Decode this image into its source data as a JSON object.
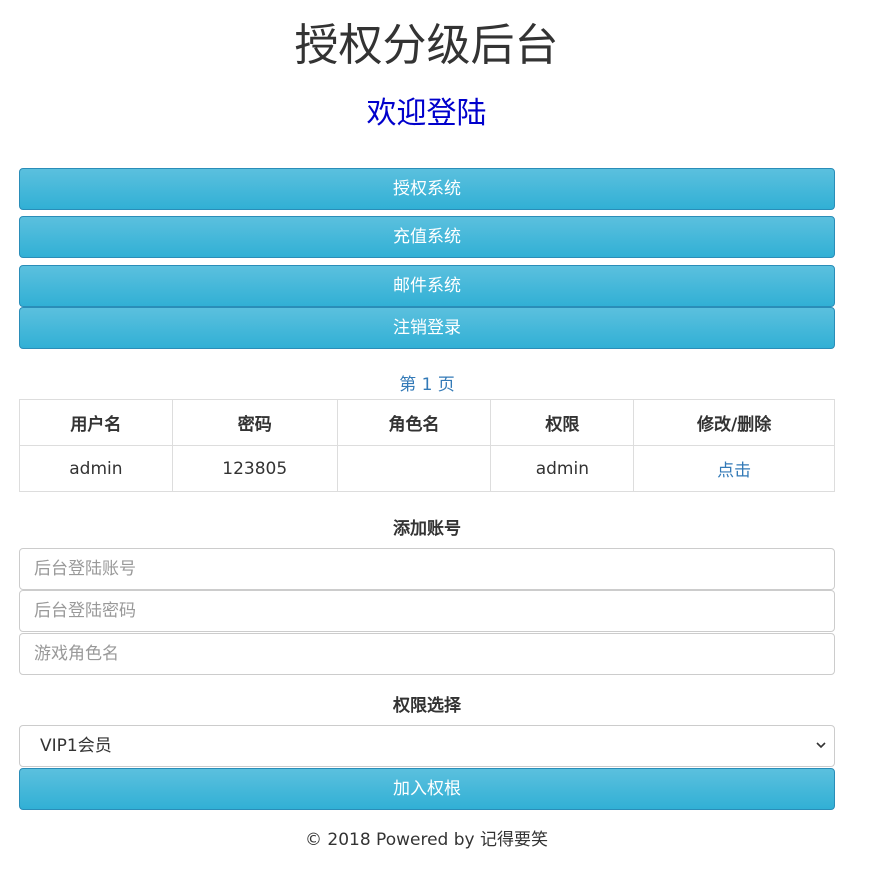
{
  "header": {
    "title": "授权分级后台",
    "welcome": "欢迎登陆"
  },
  "nav": {
    "buttons": [
      {
        "label": "授权系统"
      },
      {
        "label": "充值系统"
      },
      {
        "label": "邮件系统"
      },
      {
        "label": "注销登录"
      }
    ]
  },
  "pager": {
    "text": "第 1 页"
  },
  "table": {
    "columns": [
      "用户名",
      "密码",
      "角色名",
      "权限",
      "修改/删除"
    ],
    "rows": [
      {
        "username": "admin",
        "password": "123805",
        "role": "",
        "permission": "admin",
        "action": "点击"
      }
    ]
  },
  "add_account": {
    "heading": "添加账号",
    "username_placeholder": "后台登陆账号",
    "password_placeholder": "后台登陆密码",
    "role_placeholder": "游戏角色名"
  },
  "permission": {
    "heading": "权限选择",
    "selected": "VIP1会员",
    "submit_label": "加入权根"
  },
  "footer": {
    "text": "© 2018 Powered by 记得要笑"
  },
  "colors": {
    "button_top": "#5bc0de",
    "button_bottom": "#31b0d5",
    "link": "#337ab7",
    "welcome": "#0000cc"
  },
  "icons": {
    "select_caret": "chevron-down-icon"
  }
}
